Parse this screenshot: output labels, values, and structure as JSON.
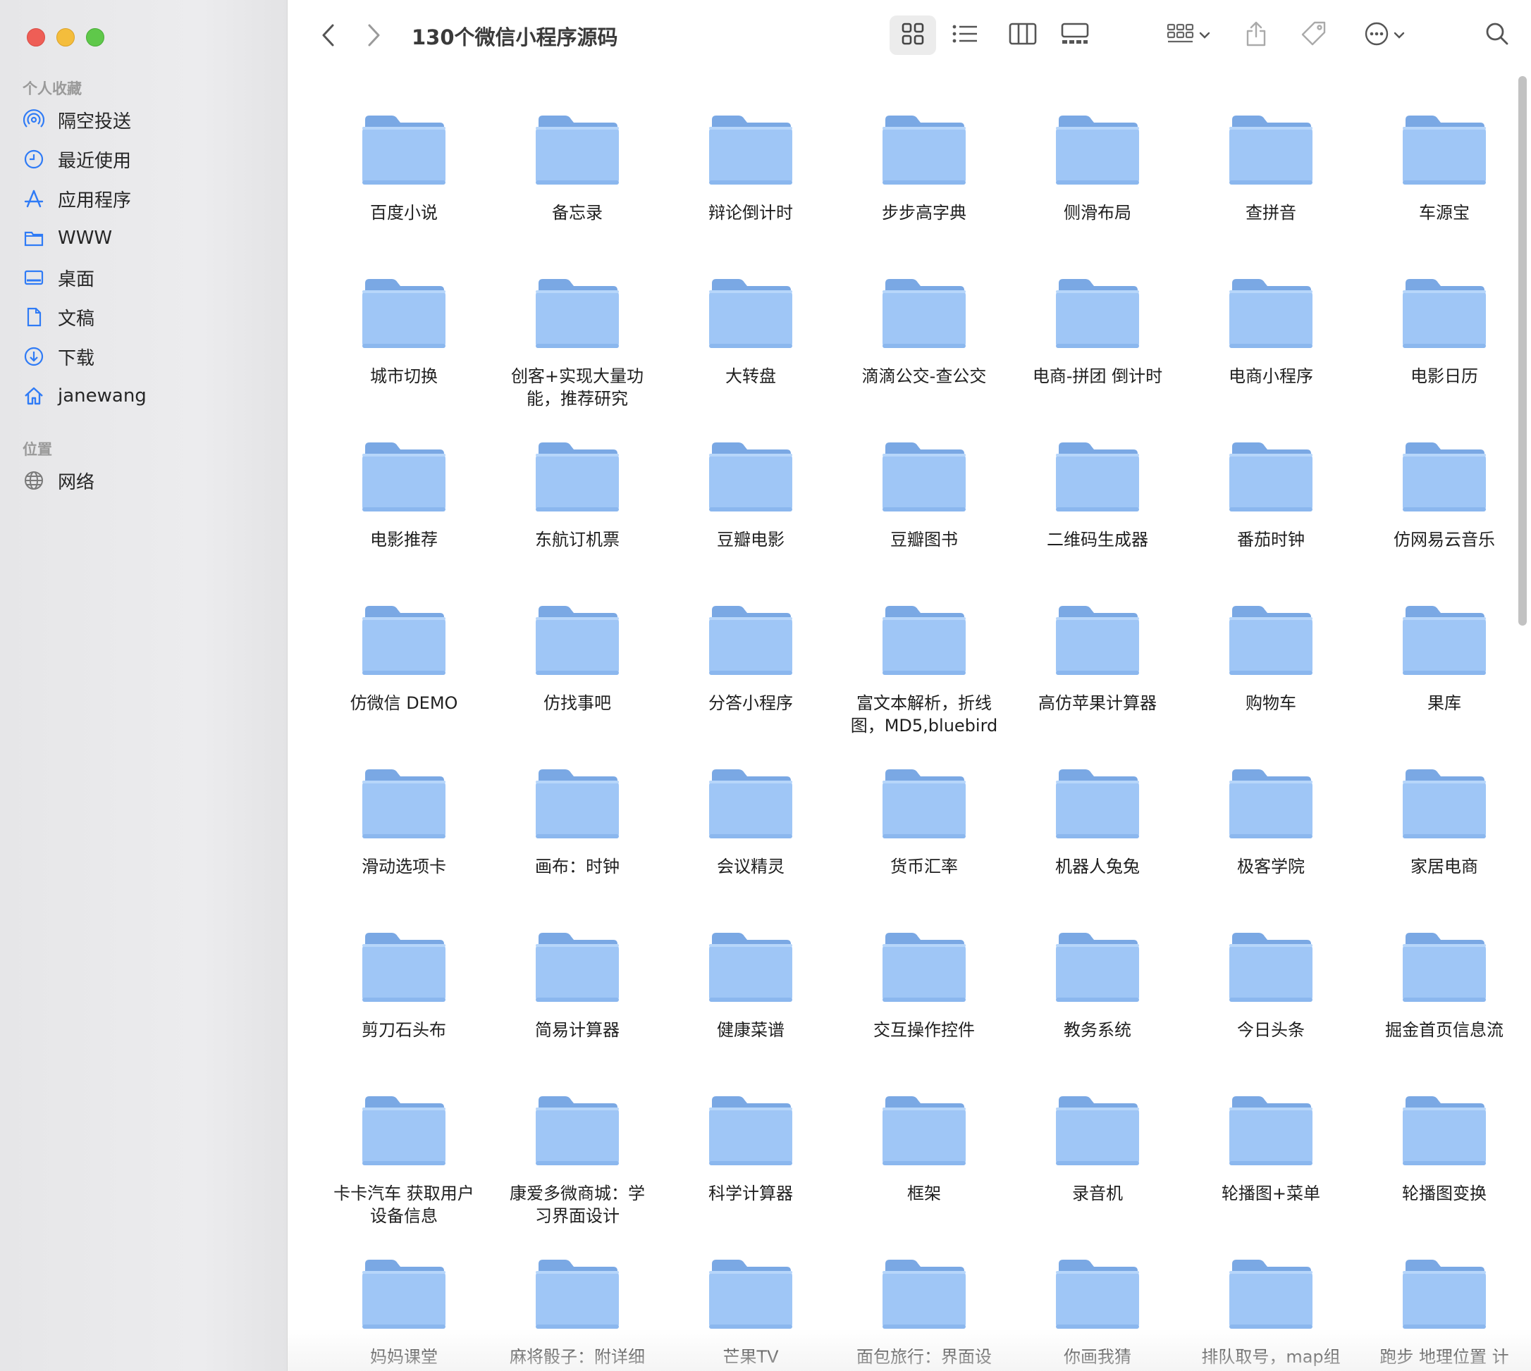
{
  "window": {
    "title": "130个微信小程序源码"
  },
  "sidebar": {
    "favorites_title": "个人收藏",
    "favorites": [
      {
        "label": "隔空投送",
        "icon": "airdrop-icon"
      },
      {
        "label": "最近使用",
        "icon": "clock-icon"
      },
      {
        "label": "应用程序",
        "icon": "applications-icon"
      },
      {
        "label": "WWW",
        "icon": "folder-icon"
      },
      {
        "label": "桌面",
        "icon": "desktop-icon"
      },
      {
        "label": "文稿",
        "icon": "document-icon"
      },
      {
        "label": "下载",
        "icon": "download-icon"
      },
      {
        "label": "janewang",
        "icon": "home-icon"
      }
    ],
    "locations_title": "位置",
    "locations": [
      {
        "label": "网络",
        "icon": "network-globe-icon"
      }
    ]
  },
  "toolbar": {
    "back_icon": "chevron-left-icon",
    "forward_icon": "chevron-right-icon",
    "view_modes": [
      "icon-view-icon",
      "list-view-icon",
      "column-view-icon",
      "gallery-view-icon"
    ],
    "active_view": "icon-view-icon",
    "group_icon": "group-by-icon",
    "share_icon": "share-icon",
    "tag_icon": "tag-icon",
    "more_icon": "more-options-icon",
    "search_icon": "search-icon"
  },
  "folders": [
    "百度小说",
    "备忘录",
    "辩论倒计时",
    "步步高字典",
    "侧滑布局",
    "查拼音",
    "车源宝",
    "城市切换",
    "创客+实现大量功能，推荐研究",
    "大转盘",
    "滴滴公交-查公交",
    "电商-拼团 倒计时",
    "电商小程序",
    "电影日历",
    "电影推荐",
    "东航订机票",
    "豆瓣电影",
    "豆瓣图书",
    "二维码生成器",
    "番茄时钟",
    "仿网易云音乐",
    "仿微信 DEMO",
    "仿找事吧",
    "分答小程序",
    "富文本解析，折线图，MD5,bluebird",
    "高仿苹果计算器",
    "购物车",
    "果库",
    "滑动选项卡",
    "画布：时钟",
    "会议精灵",
    "货币汇率",
    "机器人兔兔",
    "极客学院",
    "家居电商",
    "剪刀石头布",
    "简易计算器",
    "健康菜谱",
    "交互操作控件",
    "教务系统",
    "今日头条",
    "掘金首页信息流",
    "卡卡汽车 获取用户设备信息",
    "康爱多微商城：学习界面设计",
    "科学计算器",
    "框架",
    "录音机",
    "轮播图+菜单",
    "轮播图变换",
    "妈妈课堂",
    "麻将骰子：附详细",
    "芒果TV",
    "面包旅行：界面设",
    "你画我猜",
    "排队取号，map组",
    "跑步 地理位置 计"
  ],
  "colors": {
    "folder_body": "#9fc6f6",
    "folder_tab": "#7aa8e4",
    "accent": "#2f7bf6"
  }
}
